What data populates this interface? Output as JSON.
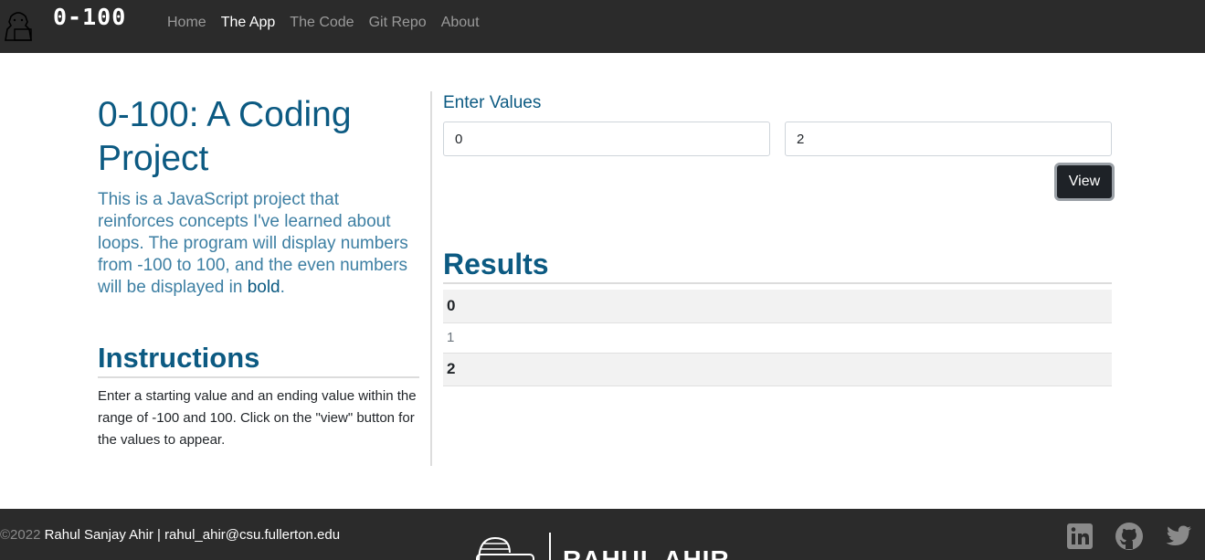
{
  "nav": {
    "brand": "0-100",
    "links": [
      "Home",
      "The App",
      "The Code",
      "Git Repo",
      "About"
    ],
    "active_index": 1
  },
  "intro": {
    "title": "0-100: A Coding Project",
    "lead_text": "This is a JavaScript project that reinforces concepts I've learned about loops. The program will display numbers from -100 to 100, and the even numbers will be displayed in ",
    "lead_bold": "bold",
    "lead_end": "."
  },
  "instructions": {
    "title": "Instructions",
    "text": "Enter a starting value and an ending value within the range of -100 and 100. Click on the \"view\" button for the values to appear."
  },
  "form": {
    "title": "Enter Values",
    "start_value": "0",
    "end_value": "2",
    "view_label": "View"
  },
  "results": {
    "title": "Results",
    "rows": [
      "0",
      "1",
      "2"
    ]
  },
  "footer": {
    "copyright": "©2022",
    "author": "Rahul Sanjay Ahir | rahul_ahir@csu.fullerton.edu",
    "logo_name": "RAHUL AHIR",
    "social": [
      "linkedin-icon",
      "github-icon",
      "twitter-icon"
    ]
  },
  "colors": {
    "nav_bg": "#2b2b2b",
    "heading": "#0c5a82",
    "button_bg": "#1e2227"
  }
}
